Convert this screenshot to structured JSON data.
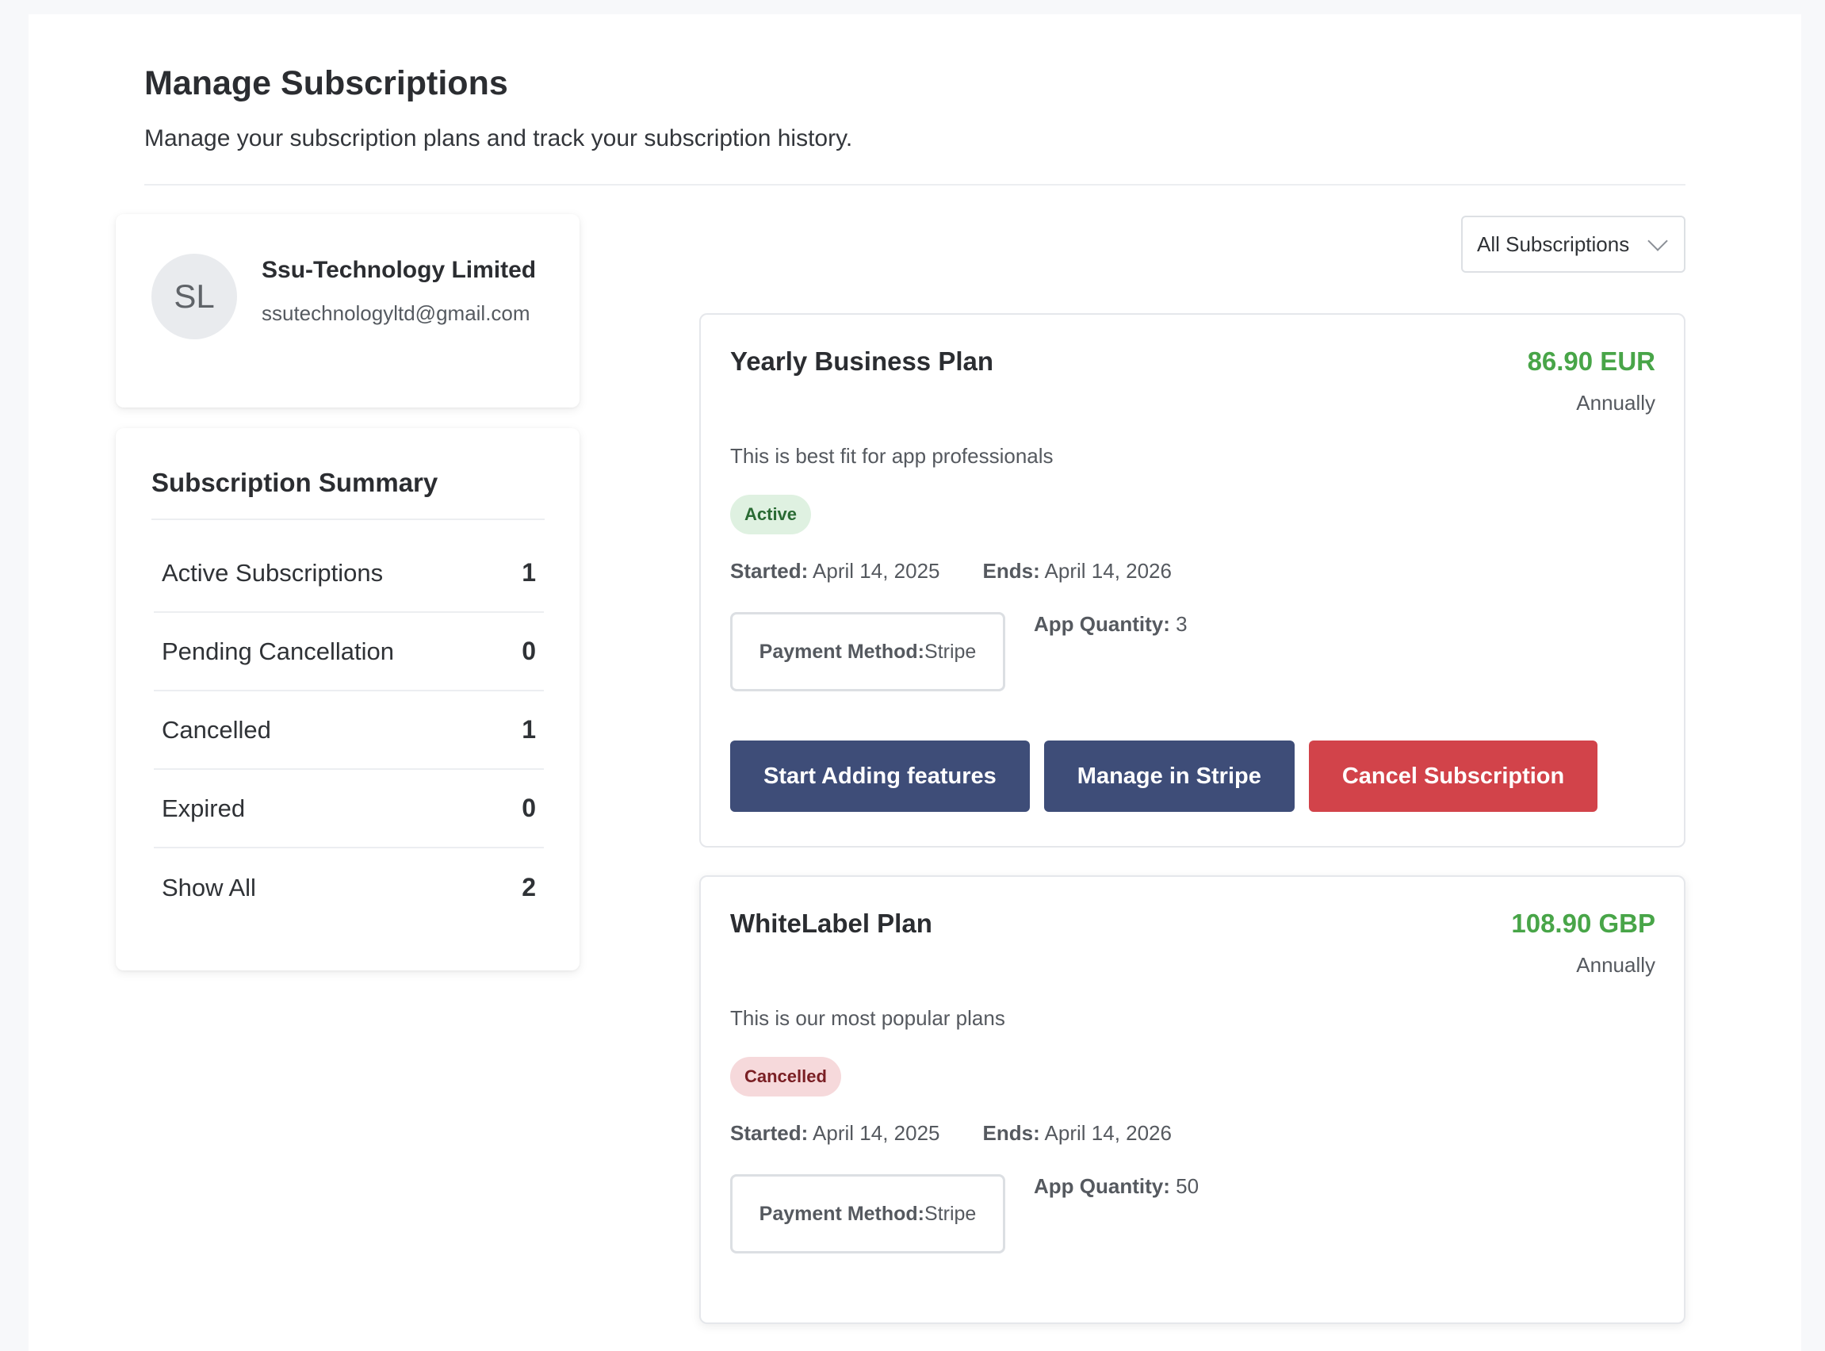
{
  "header": {
    "title": "Manage Subscriptions",
    "subtitle": "Manage your subscription plans and track your subscription history."
  },
  "profile": {
    "initials": "SL",
    "name": "Ssu-Technology Limited",
    "email": "ssutechnologyltd@gmail.com"
  },
  "summary": {
    "title": "Subscription Summary",
    "rows": [
      {
        "label": "Active Subscriptions",
        "count": "1"
      },
      {
        "label": "Pending Cancellation",
        "count": "0"
      },
      {
        "label": "Cancelled",
        "count": "1"
      },
      {
        "label": "Expired",
        "count": "0"
      },
      {
        "label": "Show All",
        "count": "2"
      }
    ]
  },
  "filter": {
    "selected": "All Subscriptions"
  },
  "subscriptions": [
    {
      "name": "Yearly Business Plan",
      "price": "86.90 EUR",
      "period": "Annually",
      "description": "This is best fit for app professionals",
      "status": "Active",
      "started_label": "Started:",
      "started": "April 14, 2025",
      "ends_label": "Ends:",
      "ends": "April 14, 2026",
      "payment_label": "Payment Method:",
      "payment": "Stripe",
      "quantity_label": "App Quantity:",
      "quantity": "3",
      "actions": {
        "add_features": "Start Adding features",
        "manage": "Manage in Stripe",
        "cancel": "Cancel Subscription"
      }
    },
    {
      "name": "WhiteLabel Plan",
      "price": "108.90 GBP",
      "period": "Annually",
      "description": "This is our most popular plans",
      "status": "Cancelled",
      "started_label": "Started:",
      "started": "April 14, 2025",
      "ends_label": "Ends:",
      "ends": "April 14, 2026",
      "payment_label": "Payment Method:",
      "payment": "Stripe",
      "quantity_label": "App Quantity:",
      "quantity": "50"
    }
  ],
  "colors": {
    "price_green": "#48a548",
    "primary_button": "#3e4d78",
    "danger_button": "#d2434a",
    "active_badge_bg": "#dff1e1",
    "cancelled_badge_bg": "#f6d9db"
  }
}
